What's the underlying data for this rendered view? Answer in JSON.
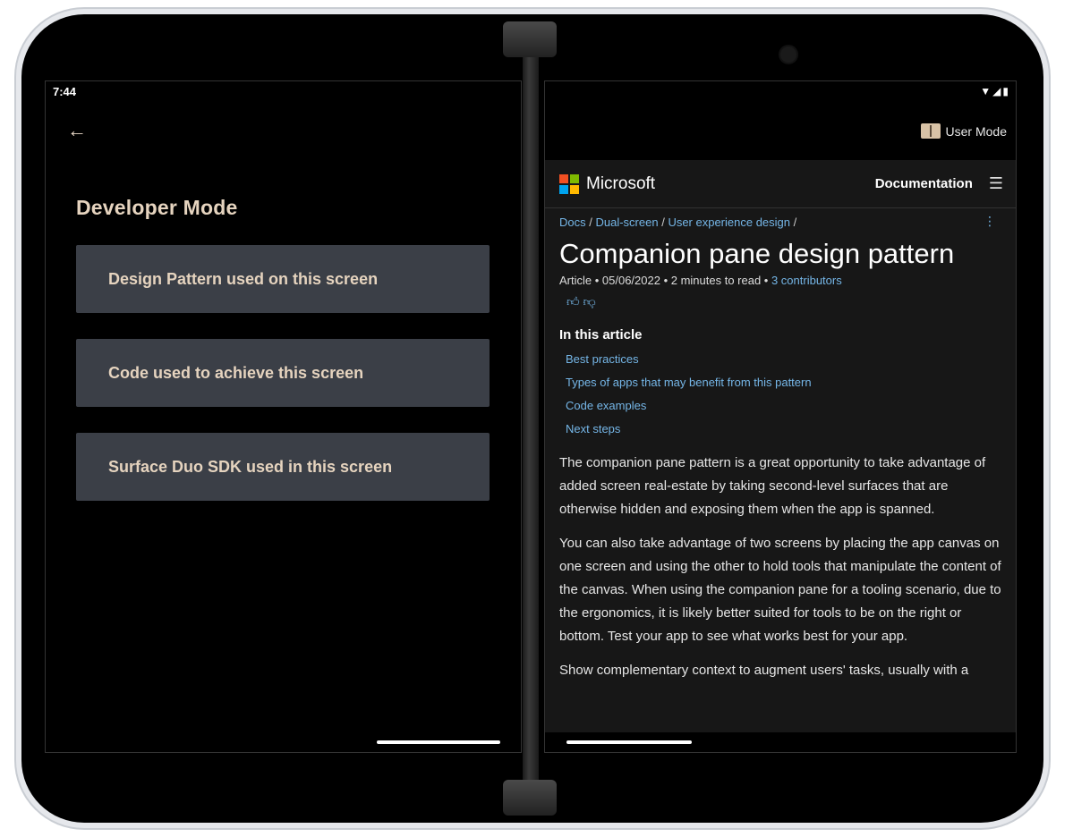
{
  "left": {
    "status_time": "7:44",
    "title": "Developer Mode",
    "buttons": [
      {
        "label": "Design Pattern used on this screen"
      },
      {
        "label": "Code used to achieve this screen"
      },
      {
        "label": "Surface Duo SDK used in this screen"
      }
    ]
  },
  "right": {
    "status_icons": "▼◢▮",
    "user_mode": "User Mode",
    "header": {
      "brand": "Microsoft",
      "nav": "Documentation",
      "logo_colors": [
        "#f25022",
        "#7fba00",
        "#00a4ef",
        "#ffb900"
      ]
    },
    "breadcrumb": [
      "Docs",
      "Dual-screen",
      "User experience design"
    ],
    "article": {
      "title": "Companion pane design pattern",
      "meta_prefix": "Article • 05/06/2022 • 2 minutes to read •",
      "contributors": "3 contributors",
      "in_this_article": "In this article",
      "toc": [
        "Best practices",
        "Types of apps that may benefit from this pattern",
        "Code examples",
        "Next steps"
      ],
      "paragraphs": [
        "The companion pane pattern is a great opportunity to take advantage of added screen real-estate by taking second-level surfaces that are otherwise hidden and exposing them when the app is spanned.",
        "You can also take advantage of two screens by placing the app canvas on one screen and using the other to hold tools that manipulate the content of the canvas. When using the companion pane for a tooling scenario, due to the ergonomics, it is likely better suited for tools to be on the right or bottom. Test your app to see what works best for your app.",
        "Show complementary context to augment users' tasks, usually with a"
      ]
    }
  }
}
